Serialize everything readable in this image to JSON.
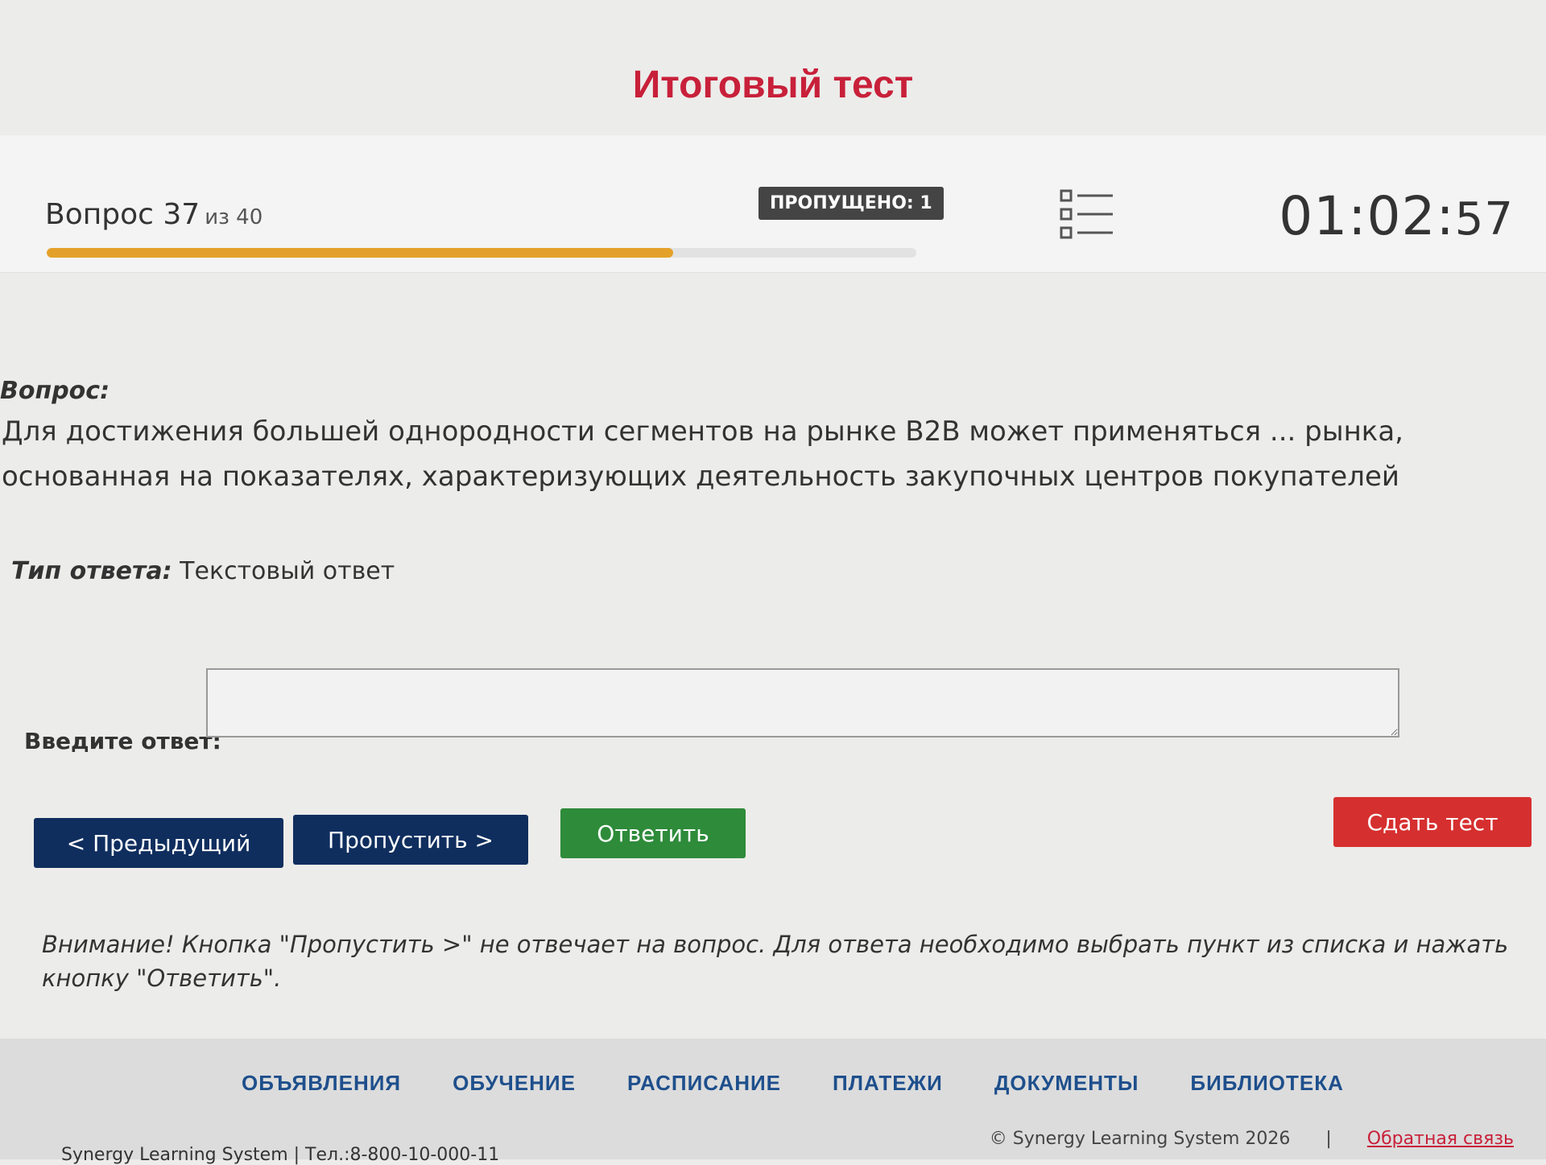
{
  "page_title": "Итоговый тест",
  "status": {
    "question_label": "Вопрос 37",
    "question_of": "из 40",
    "progress": 0.72,
    "skipped_badge": "ПРОПУЩЕНО: 1",
    "timer_hm": "01:02:",
    "timer_s": "57"
  },
  "question": {
    "label": "Вопрос:",
    "text": "Для достижения большей однородности сегментов на рынке B2B может применяться ... рынка, основанная на показателях, характеризующих деятельность закупочных центров покупателей"
  },
  "answer_type": {
    "label": "Тип ответа:",
    "value": "Текстовый ответ"
  },
  "answer": {
    "label": "Введите ответ:",
    "value": ""
  },
  "buttons": {
    "prev": "< Предыдущий",
    "skip": "Пропустить >",
    "answer": "Ответить",
    "submit": "Сдать тест"
  },
  "warning": "Внимание! Кнопка \"Пропустить >\" не отвечает на вопрос. Для ответа необходимо выбрать пункт из списка и нажать кнопку \"Ответить\".",
  "footer": {
    "nav": [
      "ОБЪЯВЛЕНИЯ",
      "ОБУЧЕНИЕ",
      "РАСПИСАНИЕ",
      "ПЛАТЕЖИ",
      "ДОКУМЕНТЫ",
      "БИБЛИОТЕКА"
    ],
    "left_text": "Synergy Learning System | Тел.:8-800-10-000-11",
    "copyright": "© Synergy Learning System 2026",
    "separator": "|",
    "feedback": "Обратная связь"
  },
  "colors": {
    "title_red": "#c8203a",
    "progress_orange": "#e4a12a",
    "nav_blue": "#0f2e5e",
    "answer_green": "#2e8b3a",
    "submit_red": "#d62f2f"
  }
}
